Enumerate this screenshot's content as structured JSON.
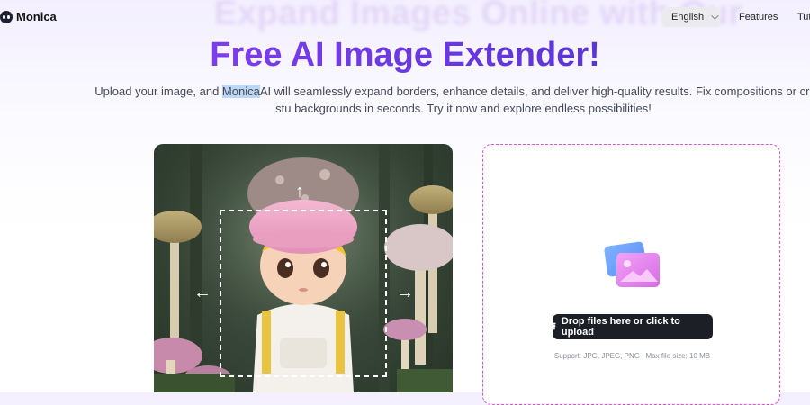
{
  "header": {
    "logo_text": "Monica",
    "ghost_title": "Expand Images Online with Our",
    "language": "English",
    "nav": [
      "Features",
      "Tut"
    ]
  },
  "hero": {
    "title": "Free AI Image Extender!",
    "desc_before": "Upload your image, and ",
    "desc_highlight": "Monica",
    "desc_after": "AI will seamlessly expand borders, enhance details, and deliver high-quality results. Fix compositions or create stu backgrounds in seconds. Try it now and explore endless possibilities!"
  },
  "upload": {
    "button_label": "Drop files here or click to upload",
    "support_text": "Support: JPG, JPEG, PNG | Max file size: 10 MB",
    "button_icon": "upload-icon"
  },
  "example": {
    "arrows": [
      "↑",
      "←",
      "→"
    ]
  },
  "colors": {
    "accent": "#6a3be0",
    "upload_border": "#e04fe0",
    "button_bg": "#1d1f26"
  }
}
